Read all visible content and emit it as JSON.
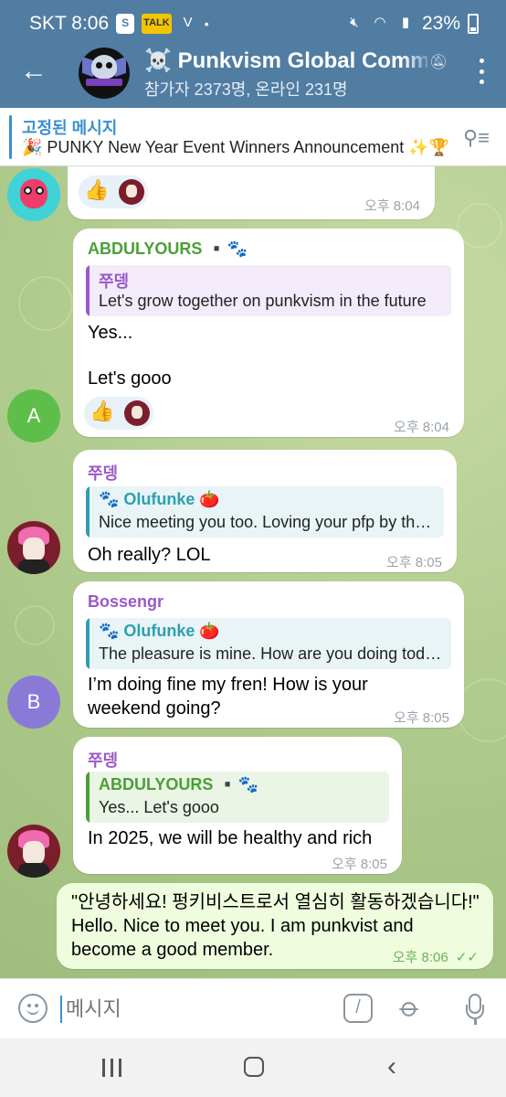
{
  "status_bar": {
    "carrier_time": "SKT 8:06",
    "dot": "•",
    "battery": "23%",
    "icons": [
      "s-app-icon",
      "kakao-icon",
      "volte-icon",
      "mute-icon",
      "wifi-icon",
      "signal-icon",
      "battery-icon"
    ]
  },
  "header": {
    "title": "Punkvism Global Community",
    "title_emoji": "☠️",
    "subtitle": "참가자 2373명, 온라인 231명"
  },
  "pinned": {
    "label": "고정된 메시지",
    "text": "🎉 PUNKY New Year Event Winners Announcement ✨🏆"
  },
  "messages": [
    {
      "kind": "incoming",
      "time": "오후 8:04",
      "reaction": "👍"
    },
    {
      "kind": "incoming",
      "sender": "ABDULYOURS ▪️🐾",
      "sender_color": "#4b9f37",
      "reply_name": "쭈뎅",
      "reply_text": "Let's grow together on punkvism in the future",
      "reply_color": "#9b59c6",
      "lines": [
        "Yes...",
        "Let's gooo"
      ],
      "reaction": "👍",
      "time": "오후 8:04",
      "avatar_letter": "A"
    },
    {
      "kind": "incoming",
      "sender": "쭈뎅",
      "sender_color": "#9b59c6",
      "reply_name": "🐾 Olufunke 🍅",
      "reply_text": "Nice meeting you too. Loving your pfp by the way",
      "reply_color": "#2e9fb0",
      "text": "Oh really? LOL",
      "time": "오후 8:05"
    },
    {
      "kind": "incoming",
      "sender": "Bossengr",
      "sender_color": "#9b59c6",
      "reply_name": "🐾 Olufunke 🍅",
      "reply_text": "The pleasure is mine. How are you doing today?",
      "reply_color": "#2e9fb0",
      "lines": [
        "I’m doing fine my fren! How is your",
        "weekend going?"
      ],
      "time": "오후 8:05",
      "avatar_letter": "B"
    },
    {
      "kind": "incoming",
      "sender": "쭈뎅",
      "sender_color": "#9b59c6",
      "reply_name": "ABDULYOURS ▪️🐾",
      "reply_text": "Yes...  Let's gooo",
      "reply_color": "#4b9f37",
      "text": "In 2025, we will be healthy and rich",
      "time": "오후 8:05"
    },
    {
      "kind": "outgoing",
      "lines": [
        "\"안녕하세요! 펑키비스트로서 열심히 활동하겠습니다!\"",
        "Hello. Nice to meet you. I am punkvist and",
        "become a good member."
      ],
      "time": "오후 8:06",
      "ticks": "✓✓"
    }
  ],
  "composer": {
    "placeholder": "메시지",
    "command_label": "/"
  },
  "colors": {
    "header": "#517da2",
    "accent": "#3a8fd0",
    "outgoing_bubble": "#effdde",
    "chat_background": "#b7cf96"
  }
}
